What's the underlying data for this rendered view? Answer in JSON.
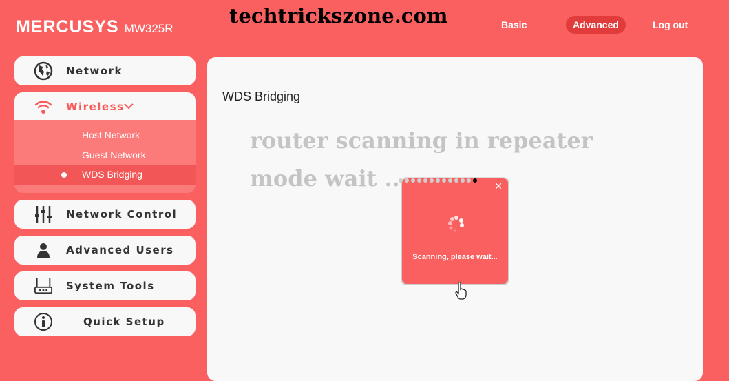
{
  "header": {
    "brand": "MERCUSYS",
    "model": "MW325R",
    "nav": [
      "Basic",
      "Advanced",
      "Log out"
    ],
    "active_nav": "Advanced"
  },
  "watermark": "techtrickszone.com",
  "sidebar": {
    "items": [
      {
        "label": "Network",
        "icon": "globe-icon"
      },
      {
        "label": "Wireless",
        "icon": "wifi-icon",
        "expanded": true,
        "subitems": [
          "Host Network",
          "Guest Network",
          "WDS Bridging"
        ],
        "active_subitem": "WDS Bridging"
      },
      {
        "label": "Network Control",
        "icon": "sliders-icon"
      },
      {
        "label": "Advanced Users",
        "icon": "user-icon"
      },
      {
        "label": "System Tools",
        "icon": "router-icon"
      },
      {
        "label": "Quick Setup",
        "icon": "info-icon"
      }
    ]
  },
  "main": {
    "title": "WDS Bridging",
    "overlay_line1": "router scanning in repeater",
    "overlay_line2": "mode wait ......"
  },
  "modal": {
    "message": "Scanning, please wait..."
  },
  "colors": {
    "brand": "#fa6060",
    "active_nav": "#e23b3b",
    "panel": "#f8f8f8"
  }
}
